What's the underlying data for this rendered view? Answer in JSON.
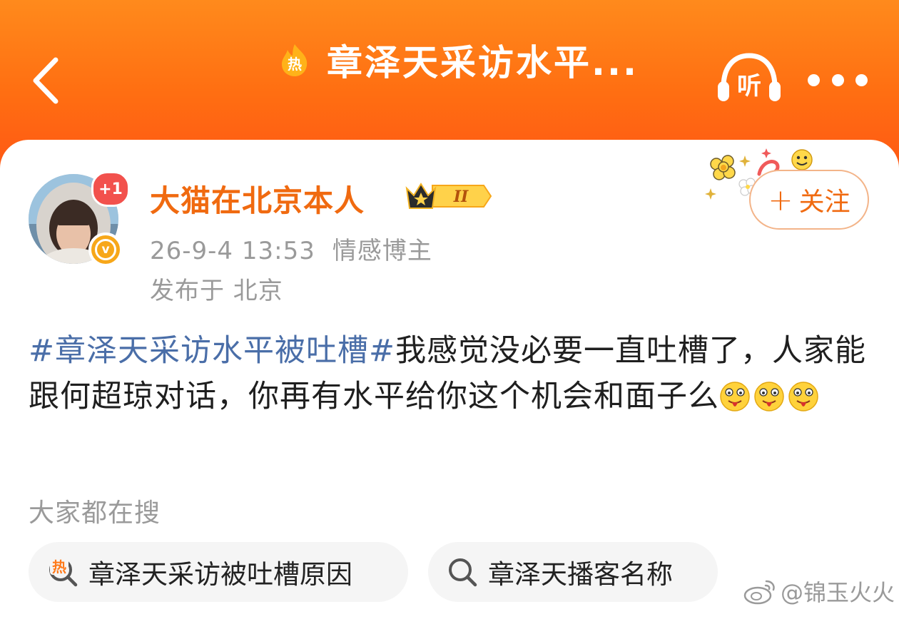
{
  "header": {
    "title": "章泽天采访水平...",
    "hot_icon_label": "热",
    "listen_label": "听",
    "colors": {
      "gradient_top": "#ff8a1c",
      "gradient_bottom": "#ff5a14"
    }
  },
  "post": {
    "author": {
      "name": "大猫在北京本人",
      "level_badge": "II",
      "notification_count": "+1",
      "verified_mark": "v"
    },
    "timestamp": "26-9-4 13:53",
    "category": "情感博主",
    "location": "发布于 北京",
    "follow_label": "关注",
    "text": {
      "hashtag": "#章泽天采访水平被吐槽#",
      "body": "我感觉没必要一直吐槽了，人家能跟何超琼对话，你再有水平给你这个机会和面子么"
    }
  },
  "search": {
    "label": "大家都在搜",
    "chips": [
      {
        "text": "章泽天采访被吐槽原因",
        "icon": "hot-search-icon",
        "hot_label": "热"
      },
      {
        "text": "章泽天播客名称",
        "icon": "search-icon"
      }
    ]
  },
  "watermark": {
    "text": "@锦玉火火"
  },
  "colors": {
    "accent": "#f06a10",
    "hashtag": "#4a6ea8",
    "secondary_text": "#9a9a9a"
  }
}
